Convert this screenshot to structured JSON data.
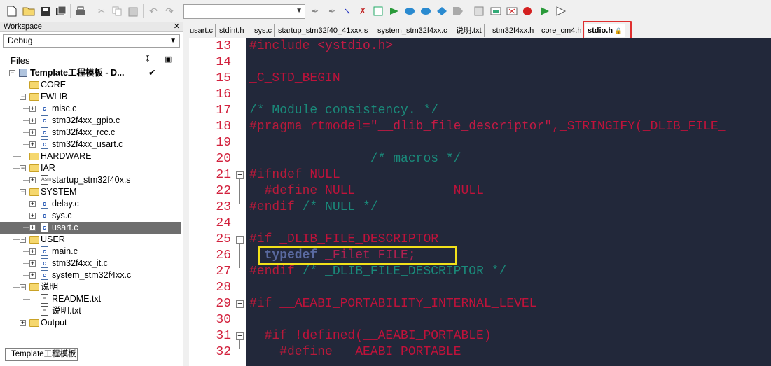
{
  "toolbar": {
    "find_value": "",
    "icons": [
      "new-file",
      "open-file",
      "save",
      "save-all",
      "print",
      "cut",
      "copy",
      "paste",
      "undo",
      "redo",
      "find-combo",
      "toggle-bookmark",
      "go-to",
      "find",
      "replace",
      "debug",
      "make",
      "rebuild",
      "download",
      "stop",
      "run",
      "step"
    ]
  },
  "workspace": {
    "title": "Workspace",
    "config": "Debug",
    "files_label": "Files",
    "bottom_tab": "Template工程模板",
    "tree": [
      {
        "label": "Template工程模板 - D...",
        "level": 0,
        "type": "project",
        "check": "✔"
      },
      {
        "label": "CORE",
        "level": 1,
        "type": "folder"
      },
      {
        "label": "FWLIB",
        "level": 1,
        "type": "folder"
      },
      {
        "label": "misc.c",
        "level": 2,
        "type": "c"
      },
      {
        "label": "stm32f4xx_gpio.c",
        "level": 2,
        "type": "c"
      },
      {
        "label": "stm32f4xx_rcc.c",
        "level": 2,
        "type": "c"
      },
      {
        "label": "stm32f4xx_usart.c",
        "level": 2,
        "type": "c"
      },
      {
        "label": "HARDWARE",
        "level": 1,
        "type": "folder"
      },
      {
        "label": "IAR",
        "level": 1,
        "type": "folder"
      },
      {
        "label": "startup_stm32f40x.s",
        "level": 2,
        "type": "asm"
      },
      {
        "label": "SYSTEM",
        "level": 1,
        "type": "folder"
      },
      {
        "label": "delay.c",
        "level": 2,
        "type": "c"
      },
      {
        "label": "sys.c",
        "level": 2,
        "type": "c"
      },
      {
        "label": "usart.c",
        "level": 2,
        "type": "c",
        "selected": true
      },
      {
        "label": "USER",
        "level": 1,
        "type": "folder"
      },
      {
        "label": "main.c",
        "level": 2,
        "type": "c"
      },
      {
        "label": "stm32f4xx_it.c",
        "level": 2,
        "type": "c"
      },
      {
        "label": "system_stm32f4xx.c",
        "level": 2,
        "type": "c"
      },
      {
        "label": "说明",
        "level": 1,
        "type": "folder"
      },
      {
        "label": "README.txt",
        "level": 2,
        "type": "txt"
      },
      {
        "label": "说明.txt",
        "level": 2,
        "type": "txt"
      },
      {
        "label": "Output",
        "level": 1,
        "type": "folder"
      }
    ]
  },
  "tabs": [
    "usart.c",
    "stdint.h",
    "sys.c",
    "startup_stm32f40_41xxx.s",
    "system_stm32f4xx.c",
    "说明.txt",
    "stm32f4xx.h",
    "core_cm4.h",
    "stdio.h"
  ],
  "active_tab": "stdio.h",
  "editor": {
    "lines": [
      {
        "n": "13",
        "parts": [
          [
            "k-pp-dim",
            "#include "
          ],
          [
            "k-str",
            "<ystdio.h>"
          ]
        ]
      },
      {
        "n": "14",
        "parts": []
      },
      {
        "n": "15",
        "parts": [
          [
            "k-id",
            "_C_STD_BEGIN"
          ]
        ]
      },
      {
        "n": "16",
        "parts": []
      },
      {
        "n": "17",
        "parts": [
          [
            "k-cm",
            "/* Module consistency. */"
          ]
        ]
      },
      {
        "n": "18",
        "parts": [
          [
            "k-pp-dim",
            "#pragma "
          ],
          [
            "k-id",
            "rtmodel="
          ],
          [
            "k-str",
            "\"__dlib_file_descriptor\""
          ],
          [
            "k-id",
            ",_STRINGIFY(_DLIB_FILE_"
          ]
        ]
      },
      {
        "n": "19",
        "parts": []
      },
      {
        "n": "20",
        "parts": [
          [
            "k-cm",
            "                /* macros */"
          ]
        ]
      },
      {
        "n": "21",
        "parts": [
          [
            "k-pp-dim",
            "#ifndef "
          ],
          [
            "k-id",
            "NULL"
          ]
        ],
        "fold": true
      },
      {
        "n": "22",
        "parts": [
          [
            "k-pp-dim",
            "  #define "
          ],
          [
            "k-id",
            "NULL            _NULL"
          ]
        ]
      },
      {
        "n": "23",
        "parts": [
          [
            "k-pp-dim",
            "#endif "
          ],
          [
            "k-cm",
            "/* NULL */"
          ]
        ]
      },
      {
        "n": "24",
        "parts": []
      },
      {
        "n": "25",
        "parts": [
          [
            "k-pp-dim",
            "#if "
          ],
          [
            "k-id",
            "_DLIB_FILE_DESCRIPTOR"
          ]
        ],
        "fold": true
      },
      {
        "n": "26",
        "parts": [
          [
            "k-kw",
            "  typedef "
          ],
          [
            "k-ty",
            "_Filet FILE;"
          ]
        ]
      },
      {
        "n": "27",
        "parts": [
          [
            "k-pp-dim",
            "#endif "
          ],
          [
            "k-cm",
            "/* _DLIB_FILE_DESCRIPTOR */"
          ]
        ]
      },
      {
        "n": "28",
        "parts": []
      },
      {
        "n": "29",
        "parts": [
          [
            "k-pp-dim",
            "#if "
          ],
          [
            "k-id",
            "__AEABI_PORTABILITY_INTERNAL_LEVEL"
          ]
        ],
        "fold": true
      },
      {
        "n": "30",
        "parts": []
      },
      {
        "n": "31",
        "parts": [
          [
            "k-pp-dim",
            "  #if "
          ],
          [
            "k-id",
            "!defined(__AEABI_PORTABLE)"
          ]
        ],
        "fold": true
      },
      {
        "n": "32",
        "parts": [
          [
            "k-pp-dim",
            "    #define "
          ],
          [
            "k-id",
            "__AEABI_PORTABLE"
          ]
        ]
      }
    ]
  }
}
